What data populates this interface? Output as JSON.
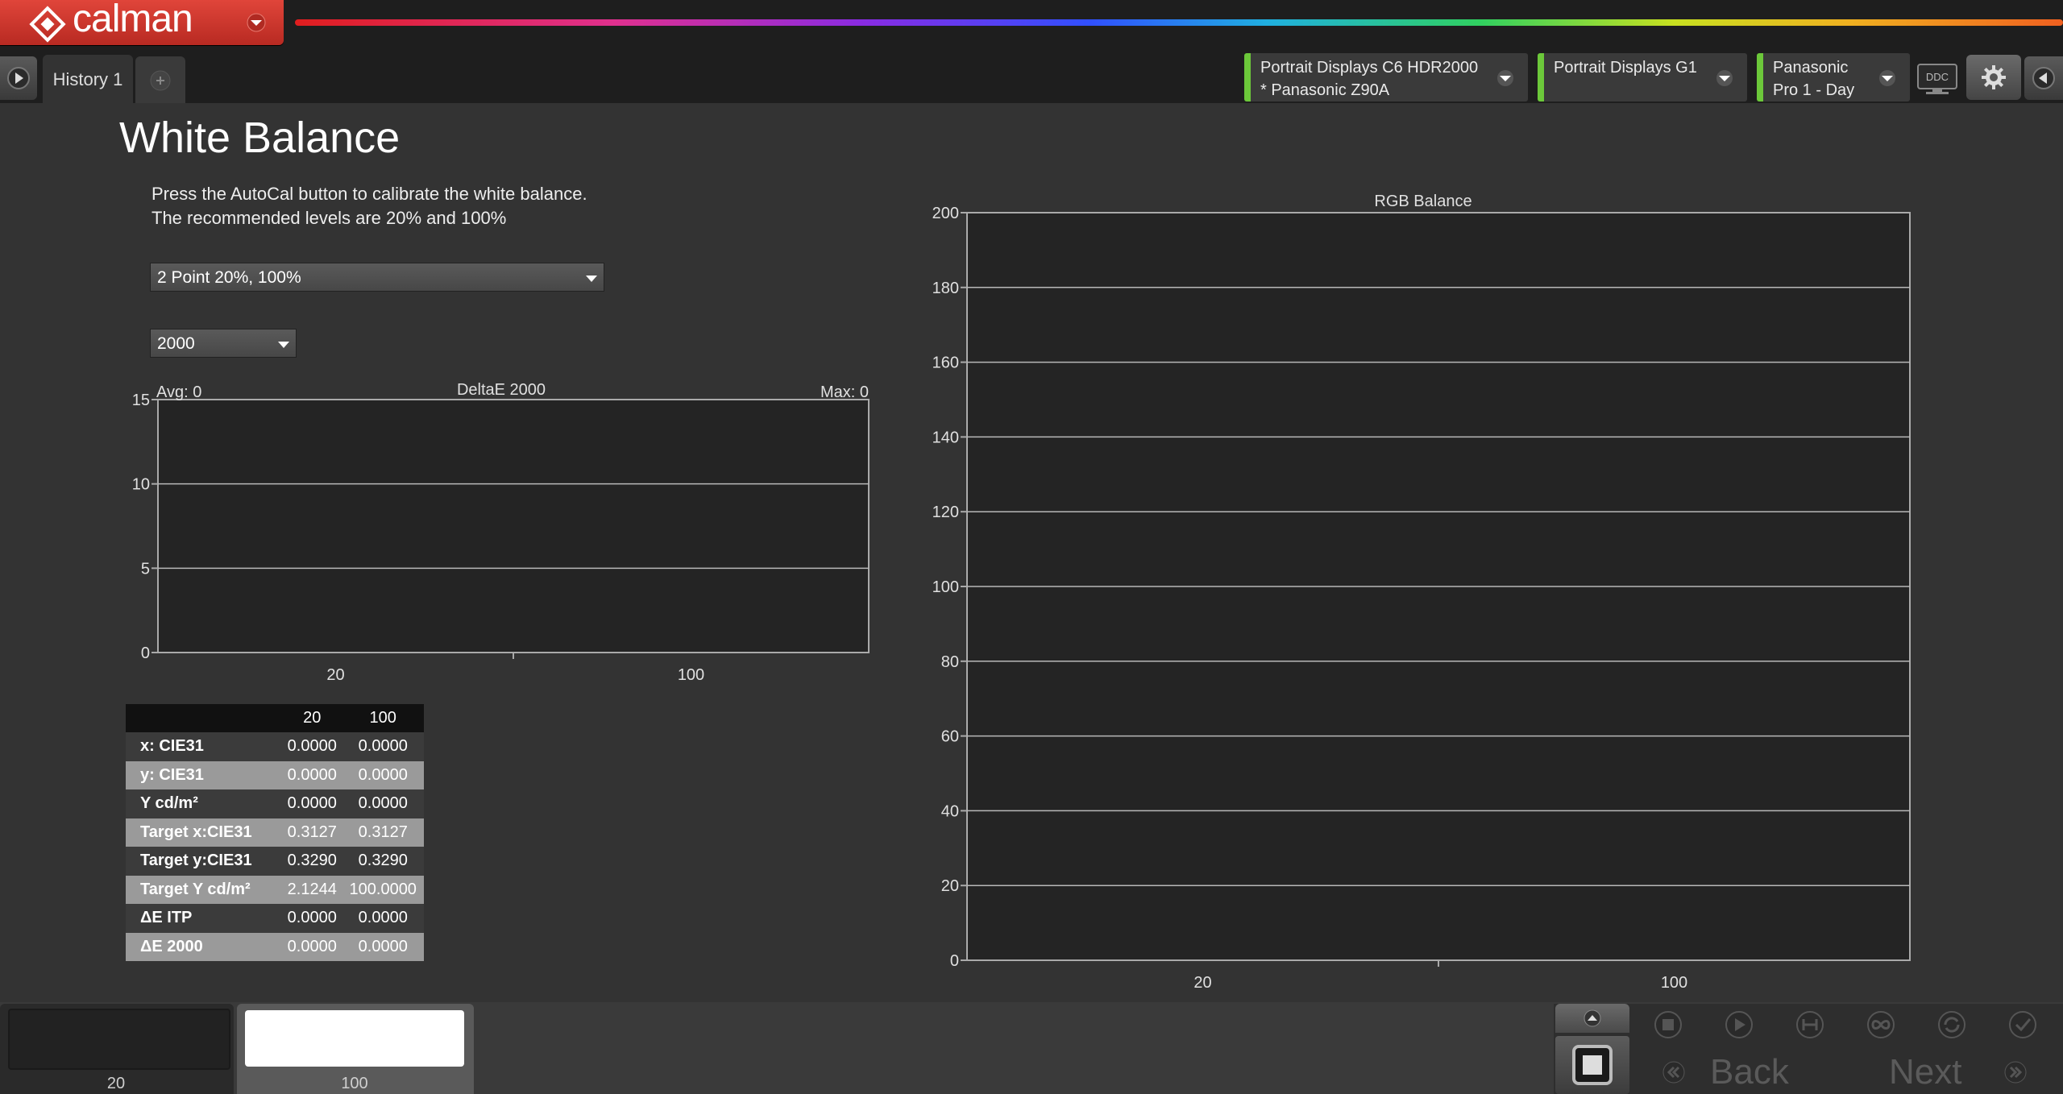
{
  "app": {
    "name": "calman"
  },
  "tabs": {
    "history_label": "History 1"
  },
  "devices": [
    {
      "line1": "Portrait Displays C6 HDR2000",
      "line2": "* Panasonic Z90A"
    },
    {
      "line1": "Portrait Displays G1",
      "line2": ""
    },
    {
      "line1": "Panasonic",
      "line2": "Pro 1 - Day"
    }
  ],
  "ddc_label": "DDC",
  "page": {
    "title": "White Balance",
    "instruction_line1": "Press the AutoCal button to calibrate the white balance.",
    "instruction_line2": "The recommended levels are 20% and 100%",
    "calibration_select": "2 Point 20%, 100%",
    "deltae_select": "2000"
  },
  "colors": {
    "accent_red": "#c8352b",
    "device_status_green": "#6cc83a",
    "chart_bg": "#242424",
    "gridline": "#b8b8b8"
  },
  "chart_data": [
    {
      "type": "bar",
      "title": "DeltaE 2000",
      "avg_label": "Avg: 0",
      "max_label": "Max: 0",
      "categories": [
        "20",
        "100"
      ],
      "values": [
        0,
        0
      ],
      "ylim": [
        0,
        15
      ],
      "yticks": [
        0,
        5,
        10,
        15
      ],
      "grid": true
    },
    {
      "type": "bar",
      "title": "RGB Balance",
      "categories": [
        "20",
        "100"
      ],
      "series": [
        {
          "values": [
            0,
            0
          ]
        },
        {
          "values": [
            0,
            0
          ]
        },
        {
          "values": [
            0,
            0
          ]
        }
      ],
      "ylim": [
        0,
        200
      ],
      "yticks": [
        0,
        20,
        40,
        60,
        80,
        100,
        120,
        140,
        160,
        180,
        200
      ],
      "grid": true
    }
  ],
  "table": {
    "columns": [
      "20",
      "100"
    ],
    "rows": [
      {
        "label": "x: CIE31",
        "values": [
          "0.0000",
          "0.0000"
        ]
      },
      {
        "label": "y: CIE31",
        "values": [
          "0.0000",
          "0.0000"
        ]
      },
      {
        "label": "Y cd/m²",
        "values": [
          "0.0000",
          "0.0000"
        ]
      },
      {
        "label": "Target x:CIE31",
        "values": [
          "0.3127",
          "0.3127"
        ]
      },
      {
        "label": "Target y:CIE31",
        "values": [
          "0.3290",
          "0.3290"
        ]
      },
      {
        "label": "Target Y cd/m²",
        "values": [
          "2.1244",
          "100.0000"
        ]
      },
      {
        "label": "ΔE ITP",
        "values": [
          "0.0000",
          "0.0000"
        ]
      },
      {
        "label": "ΔE 2000",
        "values": [
          "0.0000",
          "0.0000"
        ]
      }
    ]
  },
  "swatches": [
    {
      "label": "20",
      "color": "#222222"
    },
    {
      "label": "100",
      "color": "#ffffff"
    }
  ],
  "nav": {
    "back_label": "Back",
    "next_label": "Next"
  }
}
